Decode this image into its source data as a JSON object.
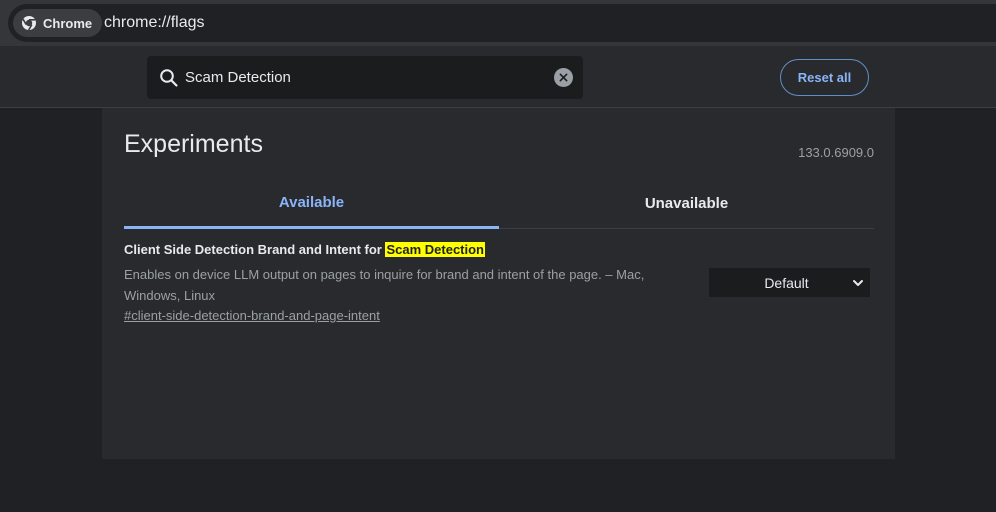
{
  "browser": {
    "chip_label": "Chrome",
    "url": "chrome://flags"
  },
  "search": {
    "value": "Scam Detection",
    "placeholder": "Search flags"
  },
  "header": {
    "reset_label": "Reset all"
  },
  "main": {
    "title": "Experiments",
    "version": "133.0.6909.0",
    "tabs": [
      {
        "label": "Available",
        "active": true
      },
      {
        "label": "Unavailable",
        "active": false
      }
    ],
    "experiments": [
      {
        "title_prefix": "Client Side Detection Brand and Intent for ",
        "title_highlight": "Scam Detection",
        "description": "Enables on device LLM output on pages to inquire for brand and intent of the page. – Mac, Windows, Linux",
        "link": "#client-side-detection-brand-and-page-intent",
        "selected_option": "Default"
      }
    ]
  },
  "colors": {
    "background": "#202124",
    "panel": "#292a2d",
    "accent": "#8ab4f8",
    "highlight": "#ffff00"
  }
}
